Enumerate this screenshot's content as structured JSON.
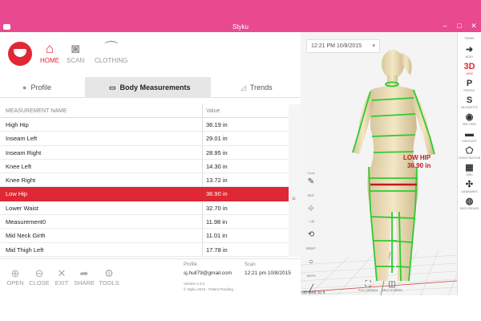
{
  "window": {
    "title": "Styku"
  },
  "nav": [
    {
      "label": "HOME",
      "icon": "home-icon",
      "active": true
    },
    {
      "label": "SCAN",
      "icon": "camera-icon",
      "active": false
    },
    {
      "label": "CLOTHING",
      "icon": "hanger-icon",
      "active": false
    }
  ],
  "tabs": [
    {
      "label": "Profile",
      "icon": "person-icon"
    },
    {
      "label": "Body Measurements",
      "icon": "tape-measure-icon",
      "active": true
    },
    {
      "label": "Trends",
      "icon": "chart-icon"
    }
  ],
  "table": {
    "headers": {
      "name": "MEASUREMENT NAME",
      "value": "Value"
    },
    "rows": [
      {
        "name": "High Hip",
        "value": "36.19 in"
      },
      {
        "name": "Inseam Left",
        "value": "29.01 in"
      },
      {
        "name": "Inseam Right",
        "value": "28.95 in"
      },
      {
        "name": "Knee Left",
        "value": "14.30 in"
      },
      {
        "name": "Knee Right",
        "value": "13.72 in"
      },
      {
        "name": "Low Hip",
        "value": "36.90 in",
        "selected": true
      },
      {
        "name": "Lower Waist",
        "value": "32.70 in"
      },
      {
        "name": "Measurement0",
        "value": "11.98 in"
      },
      {
        "name": "Mid Neck Girth",
        "value": "11.01 in"
      },
      {
        "name": "Mid Thigh Left",
        "value": "17.78 in"
      }
    ]
  },
  "toolbar": [
    {
      "label": "OPEN",
      "icon": "add-user-icon"
    },
    {
      "label": "CLOSE",
      "icon": "remove-user-icon"
    },
    {
      "label": "EXIT",
      "icon": "close-icon"
    },
    {
      "label": "SHARE",
      "icon": "share-icon"
    },
    {
      "label": "TOOLS",
      "icon": "gear-icon"
    }
  ],
  "info": {
    "profile_label": "Profile",
    "profile_value": "sj.hull79@gmail.com",
    "scan_label": "Scan",
    "scan_value": "12:21 pm 10/8/2015",
    "version": "Version 2.3.2",
    "copyright": "© Styku 2015 - Patent Pending"
  },
  "viewer": {
    "date": "12:21 PM 10/8/2015",
    "measure_label": "LOW HIP",
    "measure_value": "36.90 in",
    "axis": "3D Grid 10 ft",
    "tools_label": "Tools",
    "views_label": "Views",
    "tools": [
      {
        "label": "EDIT",
        "icon": "pencil-icon",
        "enabled": true
      },
      {
        "label": "",
        "icon": "move-icon",
        "enabled": false
      },
      {
        "label": "",
        "icon": "forward-icon",
        "enabled": false
      },
      {
        "label": "RESET",
        "icon": "reset-icon",
        "enabled": true
      },
      {
        "label": "GIRTH",
        "icon": "circle-icon",
        "enabled": true
      },
      {
        "label": "LENGTH",
        "icon": "line-icon",
        "enabled": true
      }
    ],
    "views": [
      {
        "label": "BODY",
        "icon": "arrow-icon"
      },
      {
        "label": "VIEW",
        "icon": "3d-icon",
        "glyph": "3D",
        "active": true
      },
      {
        "label": "PROFILE",
        "icon": "profile-icon",
        "glyph": "P"
      },
      {
        "label": "SILHOUETTE",
        "icon": "silhouette-icon",
        "glyph": "S"
      },
      {
        "label": "SEE-THRU",
        "icon": "eye-icon"
      },
      {
        "label": "HIGHLIGHT",
        "icon": "tape-icon"
      },
      {
        "label": "CROSS SECTION",
        "icon": "pentagon-icon"
      },
      {
        "label": "GRID",
        "icon": "grid-icon"
      },
      {
        "label": "LANDMARKS",
        "icon": "landmark-icon"
      },
      {
        "label": "FACE GROUPS",
        "icon": "globe-icon"
      }
    ],
    "bottom_tools": [
      {
        "label": "FULL SCREEN",
        "icon": "fullscreen-icon"
      },
      {
        "label": "SPLIT SCREEN",
        "icon": "split-screen-icon"
      }
    ]
  }
}
